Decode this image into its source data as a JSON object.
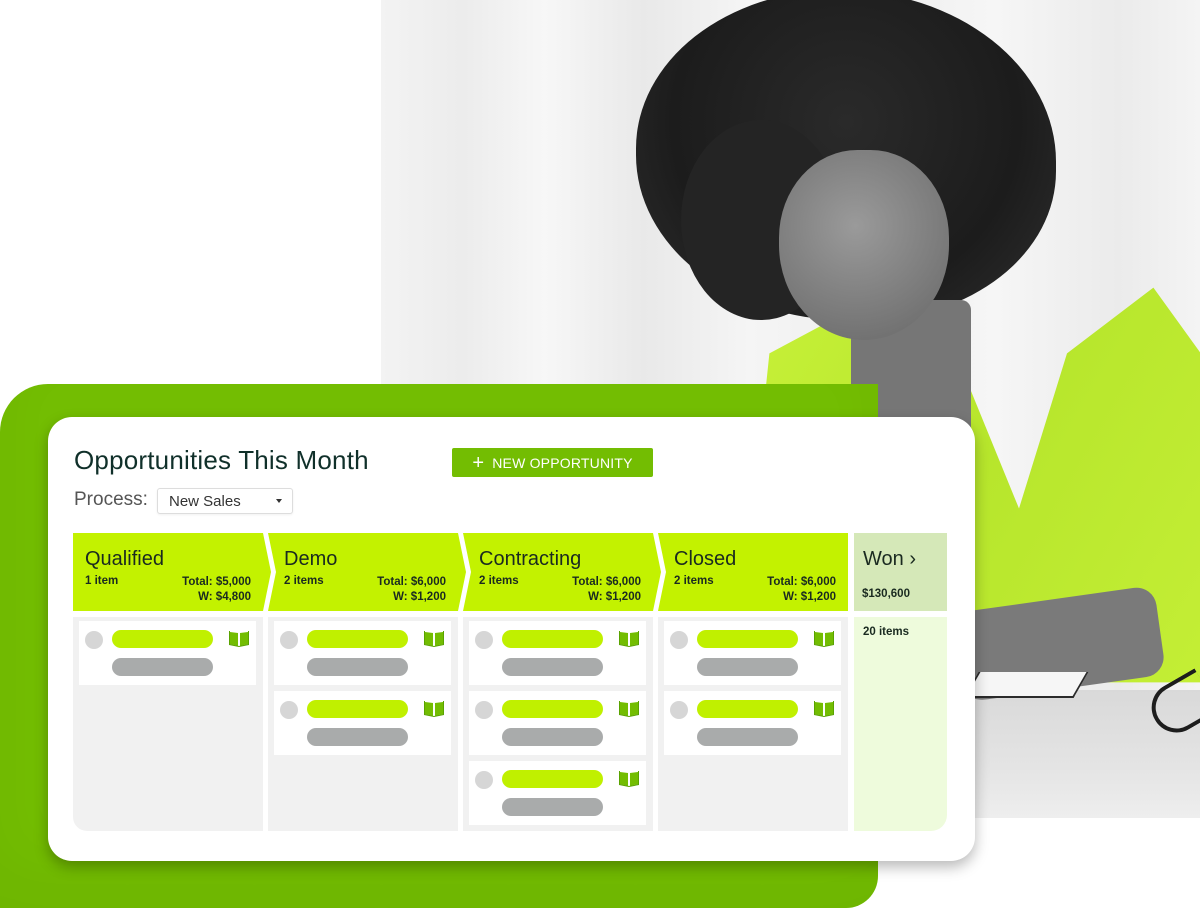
{
  "card": {
    "title": "Opportunities This Month",
    "new_button": {
      "icon": "plus-icon",
      "label": "NEW OPPORTUNITY"
    },
    "process": {
      "label": "Process:",
      "selected": "New Sales"
    }
  },
  "stages": [
    {
      "name": "Qualified",
      "count": "1 item",
      "total": "Total: $5,000",
      "weighted": "W: $4,800",
      "items": 1
    },
    {
      "name": "Demo",
      "count": "2 items",
      "total": "Total: $6,000",
      "weighted": "W: $1,200",
      "items": 2
    },
    {
      "name": "Contracting",
      "count": "2 items",
      "total": "Total: $6,000",
      "weighted": "W: $1,200",
      "items": 3
    },
    {
      "name": "Closed",
      "count": "2 items",
      "total": "Total: $6,000",
      "weighted": "W: $1,200",
      "items": 2
    }
  ],
  "won": {
    "name": "Won ›",
    "value": "$130,600",
    "count": "20 items"
  },
  "colors": {
    "brand_green": "#73bd02",
    "stage_green": "#c3f200",
    "won_header": "#d5e8b8",
    "won_column": "#eefbdc",
    "placeholder_gray": "#a9abab"
  }
}
